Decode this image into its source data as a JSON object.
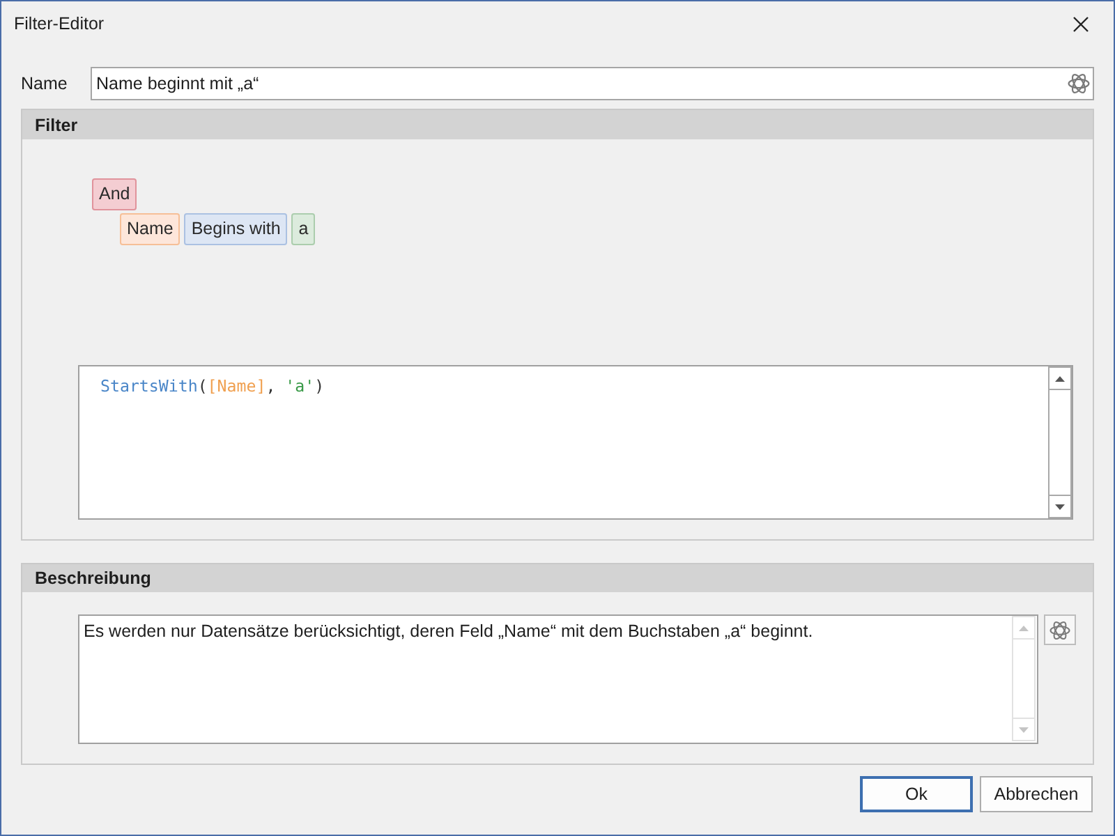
{
  "window": {
    "title": "Filter-Editor"
  },
  "name_field": {
    "label": "Name",
    "value": "Name beginnt mit „a“"
  },
  "filter": {
    "title": "Filter",
    "tree": [
      {
        "kind": "group",
        "text": "And",
        "children": [
          {
            "kind": "condition",
            "parts": [
              {
                "kind": "field",
                "text": "Name"
              },
              {
                "kind": "operator",
                "text": "Begins with"
              },
              {
                "kind": "value",
                "text": "a"
              }
            ]
          }
        ]
      }
    ],
    "expression": [
      {
        "kind": "function",
        "text": "StartsWith"
      },
      {
        "kind": "punctuation",
        "text": "("
      },
      {
        "kind": "field",
        "text": "[Name]"
      },
      {
        "kind": "punctuation",
        "text": ", "
      },
      {
        "kind": "string",
        "text": "'a'"
      },
      {
        "kind": "punctuation",
        "text": ")"
      }
    ]
  },
  "description": {
    "title": "Beschreibung",
    "text": "Es werden nur Datensätze berücksichtigt, deren Feld „Name“ mit dem Buchstaben „a“ beginnt."
  },
  "buttons": [
    {
      "label": "Ok",
      "default": true
    },
    {
      "label": "Abbrechen",
      "default": false
    }
  ]
}
